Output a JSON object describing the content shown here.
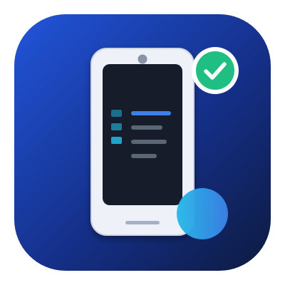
{
  "app_icon": {
    "icon_name": "mobile-checklist-app-icon",
    "colors": {
      "background_top": "#1f4fd6",
      "background_bottom": "#0f1c45",
      "phone_frame": "#eef2f8",
      "phone_screen": "#121a2b",
      "check_badge": "#1fbf83",
      "accent_bubble_start": "#2ab6e8",
      "accent_bubble_end": "#3a7fe6"
    },
    "elements": {
      "phone": "smartphone-icon",
      "check": "checkmark-badge-icon",
      "list": "task-list-icon",
      "bubble": "accent-circle"
    }
  }
}
